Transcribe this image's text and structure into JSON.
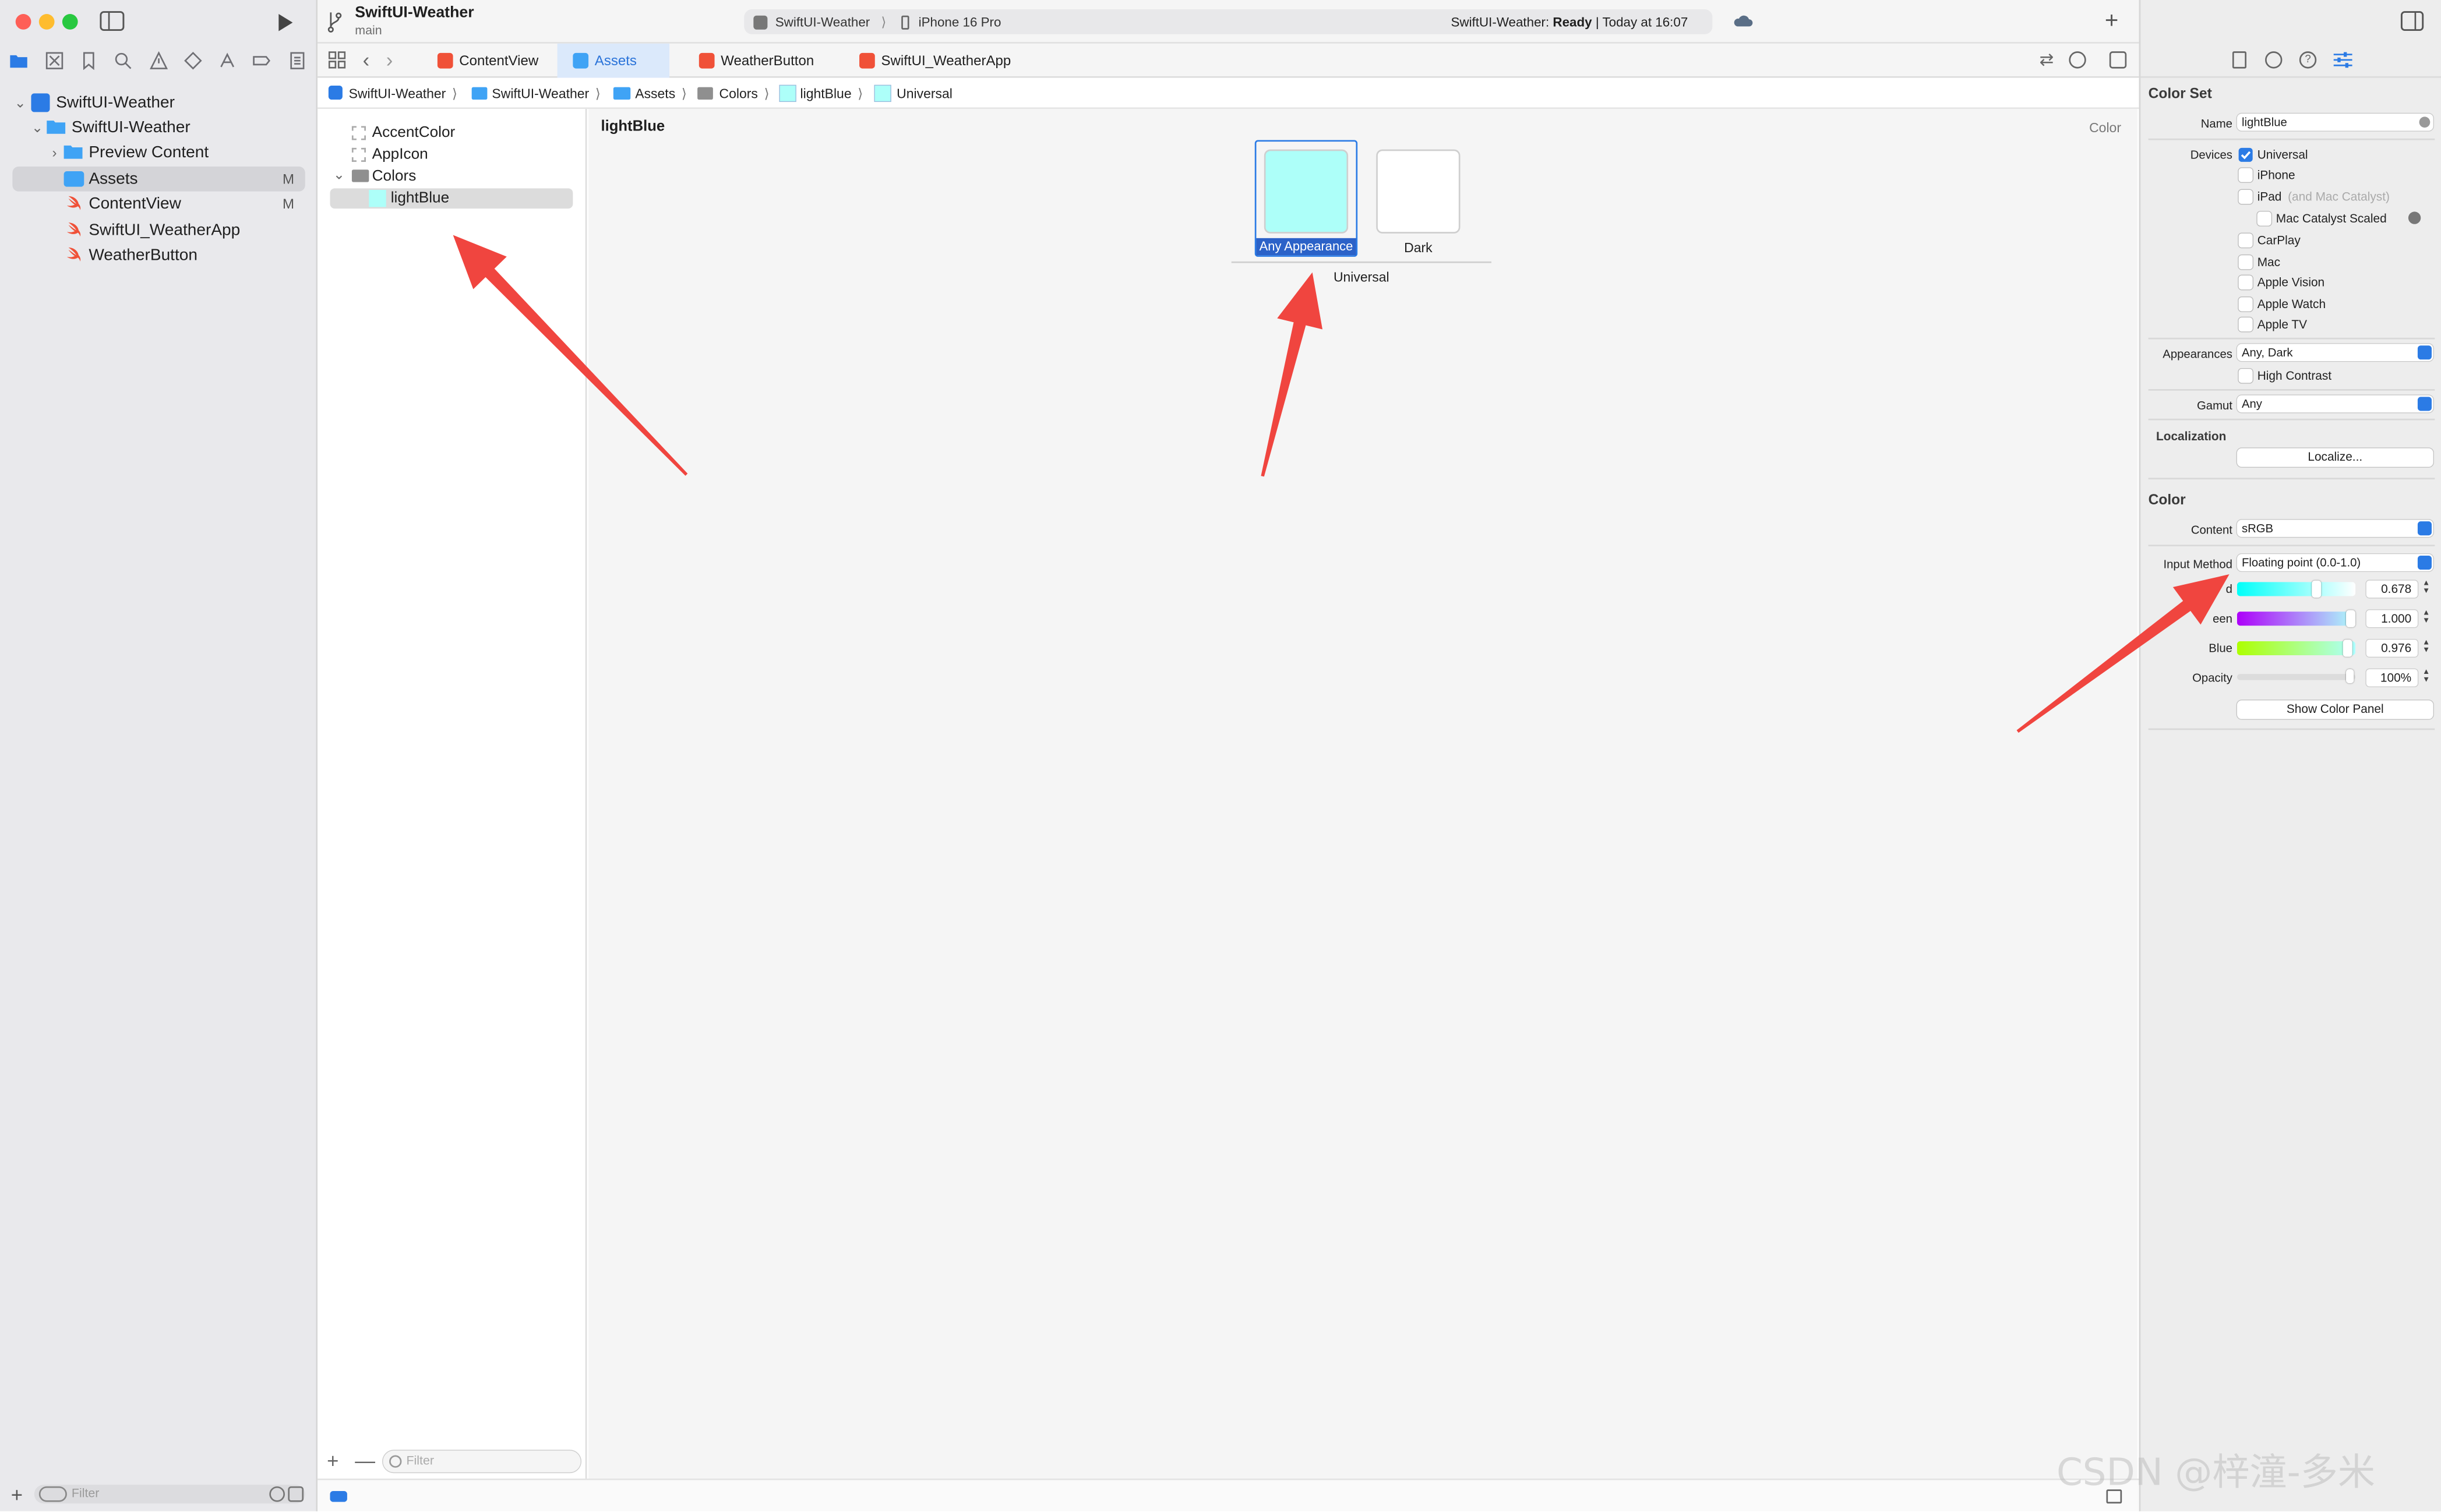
{
  "window": {
    "project_title": "SwiftUI-Weather",
    "branch": "main",
    "scheme": "SwiftUI-Weather",
    "device": "iPhone 16 Pro",
    "status_project": "SwiftUI-Weather:",
    "status_state": "Ready",
    "status_time": "| Today at 16:07"
  },
  "navigator": {
    "items": [
      {
        "label": "SwiftUI-Weather",
        "badge": ""
      },
      {
        "label": "SwiftUI-Weather",
        "badge": ""
      },
      {
        "label": "Preview Content",
        "badge": ""
      },
      {
        "label": "Assets",
        "badge": "M"
      },
      {
        "label": "ContentView",
        "badge": "M"
      },
      {
        "label": "SwiftUI_WeatherApp",
        "badge": ""
      },
      {
        "label": "WeatherButton",
        "badge": ""
      }
    ],
    "filter_placeholder": "Filter"
  },
  "tabs": [
    "ContentView",
    "Assets",
    "WeatherButton",
    "SwiftUI_WeatherApp"
  ],
  "jumpbar": [
    "SwiftUI-Weather",
    "SwiftUI-Weather",
    "Assets",
    "Colors",
    "lightBlue",
    "Universal"
  ],
  "assets": {
    "items": [
      "AccentColor",
      "AppIcon",
      "Colors",
      "lightBlue"
    ],
    "filter_placeholder": "Filter"
  },
  "canvas": {
    "title": "lightBlue",
    "kind": "Color",
    "wells": [
      "Any Appearance",
      "Dark"
    ],
    "group_label": "Universal",
    "any_color": "#adfff9",
    "dark_color": "#ffffff"
  },
  "inspector": {
    "header": "Color Set",
    "name_label": "Name",
    "name_value": "lightBlue",
    "devices_label": "Devices",
    "devices": [
      {
        "label": "Universal",
        "checked": true
      },
      {
        "label": "iPhone",
        "checked": false
      },
      {
        "label": "iPad",
        "checked": false
      },
      {
        "label": "Mac Catalyst Scaled",
        "checked": false
      },
      {
        "label": "CarPlay",
        "checked": false
      },
      {
        "label": "Mac",
        "checked": false
      },
      {
        "label": "Apple Vision",
        "checked": false
      },
      {
        "label": "Apple Watch",
        "checked": false
      },
      {
        "label": "Apple TV",
        "checked": false
      }
    ],
    "ipad_note": "(and Mac Catalyst)",
    "appearances_label": "Appearances",
    "appearances_value": "Any, Dark",
    "high_contrast": "High Contrast",
    "gamut_label": "Gamut",
    "gamut_value": "Any",
    "localization_header": "Localization",
    "localize_button": "Localize...",
    "color_header": "Color",
    "content_label": "Content",
    "content_value": "sRGB",
    "input_method_label": "Input Method",
    "input_method_value": "Floating point (0.0-1.0)",
    "red_label": "d",
    "red_value": "0.678",
    "green_label": "een",
    "green_value": "1.000",
    "blue_label": "Blue",
    "blue_value": "0.976",
    "opacity_label": "Opacity",
    "opacity_value": "100%",
    "show_color_panel": "Show Color Panel"
  },
  "watermark": "CSDN @梓潼-多米",
  "colors": {
    "accent": "#2b7be5",
    "annotation_arrow": "#f0453f"
  }
}
